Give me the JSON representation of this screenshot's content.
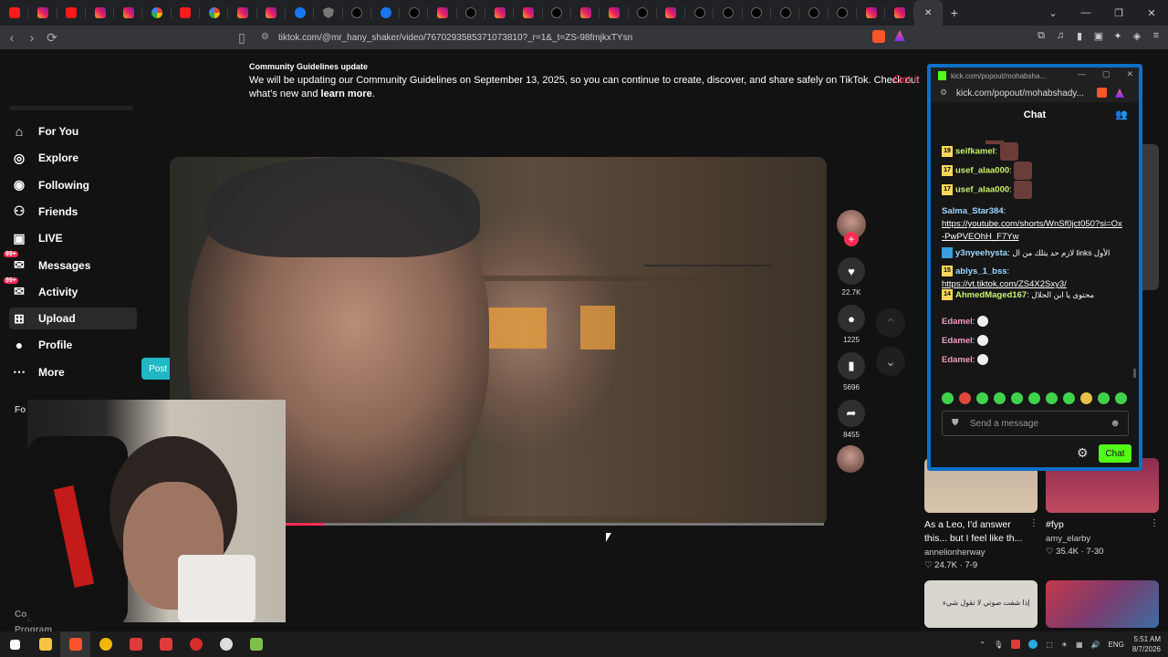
{
  "browser": {
    "tabs": [
      "yt",
      "ig",
      "yt",
      "ig",
      "ig",
      "gg",
      "yt",
      "gg",
      "ig",
      "ig",
      "fb",
      "sh",
      "tt",
      "fb",
      "tt",
      "ig",
      "tt",
      "ig",
      "ig",
      "tt",
      "ig",
      "ig",
      "tt",
      "ig",
      "tt",
      "tt",
      "tt",
      "tt",
      "tt",
      "tt",
      "ig",
      "ig"
    ],
    "new_tab_icon": "+",
    "url": "tiktok.com/@mr_hany_shaker/video/7670293585371073810?_r=1&_t=ZS-98fmjkxTYsn"
  },
  "tiktok": {
    "banner_title": "Community Guidelines update",
    "banner_text_pre": "We will be updating our Community Guidelines on September 13, 2025, so you can continue to create, discover, and share safely on TikTok. Check out what's new and ",
    "banner_link": "learn more",
    "banner_text_post": ".",
    "got_it": "Got it",
    "nav": [
      {
        "label": "For You",
        "icon": "home-icon"
      },
      {
        "label": "Explore",
        "icon": "compass-icon"
      },
      {
        "label": "Following",
        "icon": "following-icon"
      },
      {
        "label": "Friends",
        "icon": "friends-icon"
      },
      {
        "label": "LIVE",
        "icon": "live-icon"
      },
      {
        "label": "Messages",
        "icon": "messages-icon",
        "badge": "99+"
      },
      {
        "label": "Activity",
        "icon": "activity-icon",
        "badge": "99+"
      },
      {
        "label": "Upload",
        "icon": "upload-icon"
      },
      {
        "label": "Profile",
        "icon": "profile-icon"
      },
      {
        "label": "More",
        "icon": "more-icon"
      }
    ],
    "post_video": "Post video",
    "sidebar_partial_top": "Fo",
    "sidebar_partial_bottom_1": "Co",
    "sidebar_partial_bottom_2": "Program",
    "video_progress": 0.07,
    "actions": {
      "likes": "22.7K",
      "comments": "1225",
      "saves": "5696",
      "shares": "8455"
    },
    "right_videos": [
      {
        "title": "As a Leo, I'd answer this... but I feel like th...",
        "user": "annelionherway",
        "likes": "24.7K",
        "date": "7-9"
      },
      {
        "title": "#fyp",
        "user": "amy_elarby",
        "likes": "35.4K",
        "date": "7-30"
      }
    ],
    "thumb_overlay_text": "إذا شفت صوتي لا تقول شيء"
  },
  "kick": {
    "window_title": "kick.com/popout/mohabsha...",
    "url": "kick.com/popout/mohabshady...",
    "chat_title": "Chat",
    "messages": [
      {
        "level": "19",
        "user": "seifkamel",
        "color": "#c8f26a",
        "text": ""
      },
      {
        "level": "17",
        "user": "usef_alaa000",
        "color": "#c8f26a",
        "text": ""
      },
      {
        "level": "17",
        "user": "usef_alaa000",
        "color": "#c8f26a",
        "text": ""
      },
      {
        "level": "",
        "user": "Salma_Star384",
        "color": "#9fd7ff",
        "text": "https://youtube.com/shorts/WnSf0jct050?si=Ox-PwPVEOhH_F7Yw"
      },
      {
        "level": "",
        "user": "y3nyeehysta",
        "color": "#9fd7ff",
        "text": "الأول links لازم حد يتلك من ال"
      },
      {
        "level": "15",
        "user": "ablys_1_bss",
        "color": "#9fd7ff",
        "text": "https://vt.tiktok.com/ZS4X2Sxy3/"
      },
      {
        "level": "14",
        "user": "AhmedMaged167",
        "color": "#c8f26a",
        "text": "محتوى يا ابن الحلال"
      },
      {
        "level": "",
        "user": "Edamel",
        "color": "#f49ac1",
        "text": ""
      },
      {
        "level": "",
        "user": "Edamel",
        "color": "#f49ac1",
        "text": ""
      },
      {
        "level": "",
        "user": "Edamel",
        "color": "#f49ac1",
        "text": ""
      }
    ],
    "input_placeholder": "Send a message",
    "chat_button": "Chat"
  },
  "taskbar": {
    "lang": "ENG",
    "time": "5:51 AM",
    "date": "8/7/2026"
  }
}
